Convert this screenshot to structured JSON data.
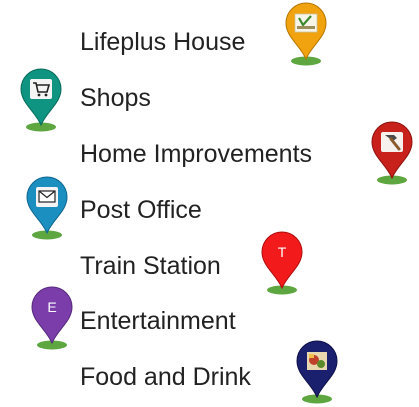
{
  "legend": {
    "items": [
      {
        "label": "Lifeplus House",
        "marker": {
          "icon": "lifeplus-logo-icon",
          "color": "#F0A20F",
          "text": ""
        }
      },
      {
        "label": "Shops",
        "marker": {
          "icon": "shopping-cart-icon",
          "color": "#0E9480",
          "text": ""
        }
      },
      {
        "label": "Home Improvements",
        "marker": {
          "icon": "hammer-icon",
          "color": "#C8201A",
          "text": ""
        }
      },
      {
        "label": "Post Office",
        "marker": {
          "icon": "envelope-icon",
          "color": "#1B8FC0",
          "text": ""
        }
      },
      {
        "label": "Train Station",
        "marker": {
          "icon": "letter-t-icon",
          "color": "#F21A1A",
          "text": "T"
        }
      },
      {
        "label": "Entertainment",
        "marker": {
          "icon": "letter-e-icon",
          "color": "#7A3DAA",
          "text": "E"
        }
      },
      {
        "label": "Food and Drink",
        "marker": {
          "icon": "food-photo-icon",
          "color": "#1A1F6E",
          "text": ""
        }
      }
    ],
    "marker_base_color": "#5DA640"
  }
}
